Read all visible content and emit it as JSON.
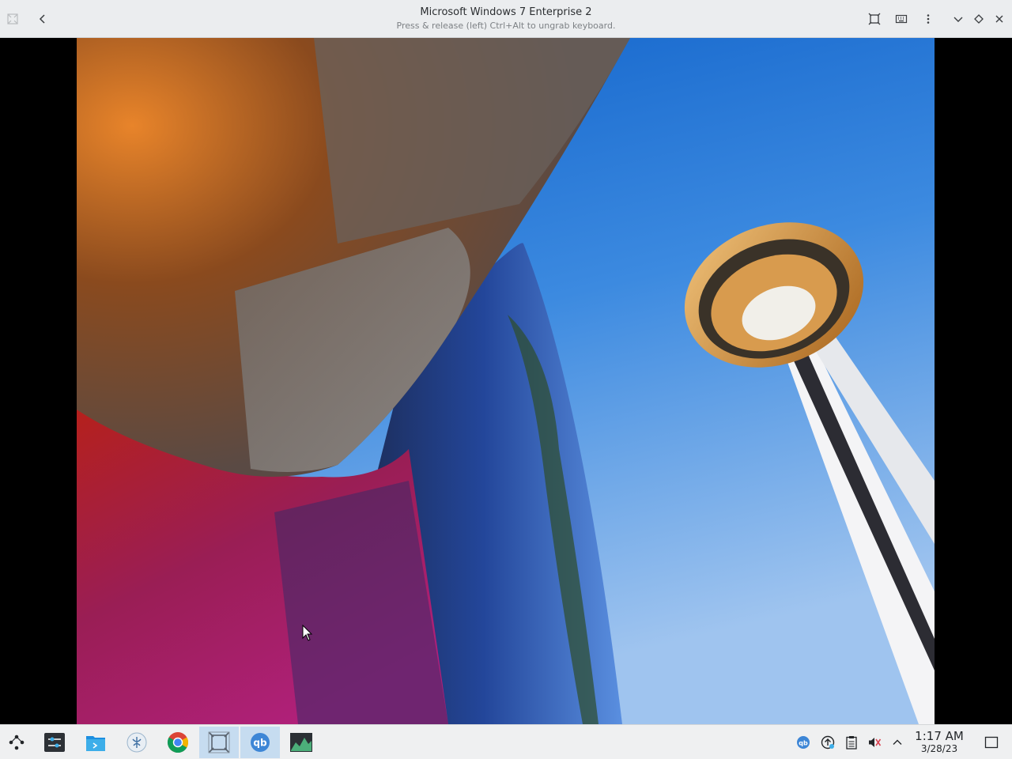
{
  "window": {
    "title": "Microsoft Windows 7 Enterprise 2",
    "subtitle": "Press & release (left) Ctrl+Alt to ungrab keyboard."
  },
  "titlebar_icons": [
    "app-menu-icon",
    "back-arrow-icon",
    "fit-window-icon",
    "keyboard-icon",
    "kebab-menu-icon",
    "minimize-icon",
    "maximize-icon",
    "close-icon"
  ],
  "guest_screen": {
    "wallpaper": "Space Needle and building facade photo"
  },
  "taskbar": {
    "apps": [
      {
        "name": "application-launcher"
      },
      {
        "name": "system-settings"
      },
      {
        "name": "file-manager"
      },
      {
        "name": "discover-store"
      },
      {
        "name": "google-chrome"
      },
      {
        "name": "virtual-machine-manager",
        "active": true
      },
      {
        "name": "qbittorrent",
        "active": true
      },
      {
        "name": "system-monitor"
      }
    ],
    "tray": [
      "qbittorrent-tray",
      "update-notifier",
      "clipboard",
      "volume-muted",
      "show-hidden"
    ],
    "clock": {
      "time": "1:17 AM",
      "date": "3/28/23"
    }
  },
  "colors": {
    "titlebar_bg": "#ebedef",
    "taskbar_bg": "#eff0f1",
    "active_task": "#c6dcf0",
    "accent_blue": "#3daee9"
  }
}
